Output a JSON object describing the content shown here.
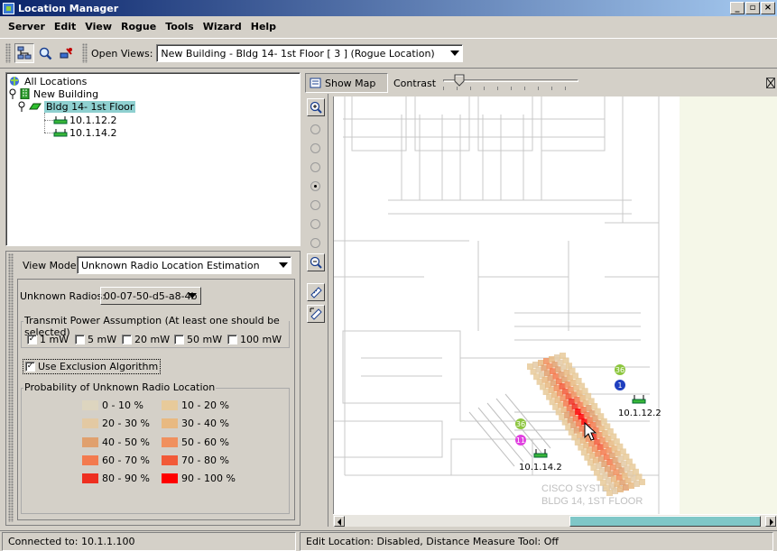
{
  "window": {
    "title": "Location Manager"
  },
  "menu": [
    "Server",
    "Edit",
    "View",
    "Rogue",
    "Tools",
    "Wizard",
    "Help"
  ],
  "toolbar": {
    "open_views_label": "Open Views:",
    "open_views_value": "New Building - Bldg 14- 1st Floor [ 3 ] (Rogue Location)"
  },
  "tree": {
    "root": "All Locations",
    "building": "New Building",
    "floor": "Bldg 14- 1st Floor",
    "aps": [
      "10.1.12.2",
      "10.1.14.2"
    ]
  },
  "options": {
    "view_mode_label": "View Mode:",
    "view_mode_value": "Unknown Radio Location Estimation",
    "unknown_radios_label": "Unknown Radios:",
    "unknown_radios_value": "00-07-50-d5-a8-4b",
    "transmit_group_label": "Transmit Power Assumption (At least one should be selected)",
    "power_options": [
      {
        "label": "1 mW",
        "checked": true
      },
      {
        "label": "5 mW",
        "checked": false
      },
      {
        "label": "20 mW",
        "checked": false
      },
      {
        "label": "50 mW",
        "checked": false
      },
      {
        "label": "100 mW",
        "checked": false
      }
    ],
    "exclusion_label": "Use Exclusion Algorithm",
    "exclusion_checked": true,
    "probability_group_label": "Probability of Unknown Radio Location",
    "legend": [
      {
        "label": "0 - 10 %",
        "color": "#ddd5bf"
      },
      {
        "label": "10 - 20 %",
        "color": "#e7ca9a"
      },
      {
        "label": "20 - 30 %",
        "color": "#e3c9a3"
      },
      {
        "label": "30 - 40 %",
        "color": "#e8b981"
      },
      {
        "label": "40 - 50 %",
        "color": "#e0a06e"
      },
      {
        "label": "50 - 60 %",
        "color": "#f0905e"
      },
      {
        "label": "60 - 70 %",
        "color": "#f37a4e"
      },
      {
        "label": "70 - 80 %",
        "color": "#f25a38"
      },
      {
        "label": "80 - 90 %",
        "color": "#ee2f20"
      },
      {
        "label": "90 - 100 %",
        "color": "#ff0000"
      }
    ]
  },
  "map": {
    "show_map_label": "Show Map",
    "contrast_label": "Contrast",
    "zoom_selected_level": 4,
    "zoom_levels": 7,
    "markers": [
      {
        "label": "36",
        "color": "#8dc63f"
      },
      {
        "label": "1",
        "color": "#1f3fbf"
      },
      {
        "label": "36",
        "color": "#8dc63f"
      },
      {
        "label": "11",
        "color": "#e040e0"
      }
    ],
    "ap_labels": [
      "10.1.12.2",
      "10.1.14.2"
    ],
    "watermark_lines": [
      "CISCO SYSTEMS",
      "BLDG 14, 1ST FLOOR"
    ]
  },
  "status": {
    "left": "Connected to: 10.1.1.100",
    "right": "Edit Location: Disabled, Distance Measure Tool: Off"
  }
}
